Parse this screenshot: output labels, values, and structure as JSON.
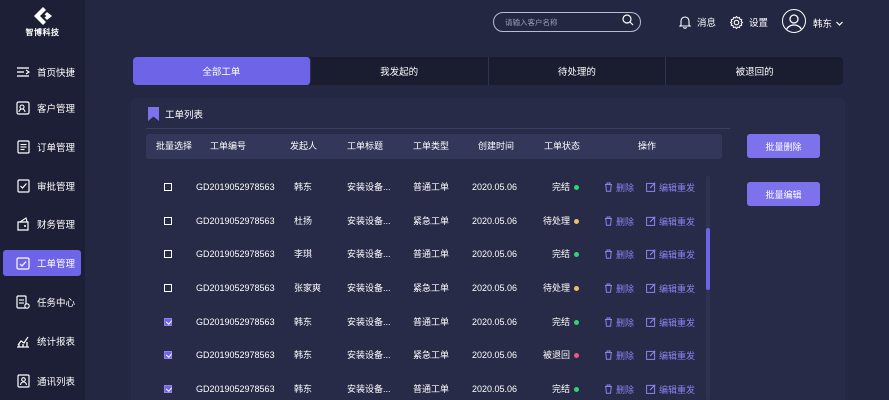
{
  "brand": {
    "name": "智博科技"
  },
  "sidebar": {
    "items": [
      {
        "label": "首页快捷",
        "icon": "quick-menu-icon",
        "active": false
      },
      {
        "label": "客户管理",
        "icon": "customer-icon",
        "active": false
      },
      {
        "label": "订单管理",
        "icon": "order-icon",
        "active": false
      },
      {
        "label": "审批管理",
        "icon": "approval-icon",
        "active": false
      },
      {
        "label": "财务管理",
        "icon": "finance-icon",
        "active": false
      },
      {
        "label": "工单管理",
        "icon": "workorder-icon",
        "active": true
      },
      {
        "label": "任务中心",
        "icon": "task-icon",
        "active": false
      },
      {
        "label": "统计报表",
        "icon": "report-icon",
        "active": false
      },
      {
        "label": "通讯列表",
        "icon": "contacts-icon",
        "active": false
      }
    ]
  },
  "header": {
    "search_placeholder": "请输入客户名称",
    "messages_label": "消息",
    "settings_label": "设置",
    "user_name": "韩东"
  },
  "tabs": [
    {
      "label": "全部工单",
      "active": true
    },
    {
      "label": "我发起的",
      "active": false
    },
    {
      "label": "待处理的",
      "active": false
    },
    {
      "label": "被退回的",
      "active": false
    }
  ],
  "panel": {
    "title": "工单列表"
  },
  "table": {
    "headers": [
      "批量选择",
      "工单编号",
      "发起人",
      "工单标题",
      "工单类型",
      "创建时间",
      "工单状态",
      "操作"
    ],
    "delete_label": "删除",
    "edit_label": "编辑重发",
    "rows": [
      {
        "checked": false,
        "id": "GD2019052978563",
        "initiator": "韩东",
        "title": "安装设备...",
        "type": "普通工单",
        "date": "2020.05.06",
        "status": "完结",
        "status_color": "#34d17a"
      },
      {
        "checked": false,
        "id": "GD2019052978563",
        "initiator": "杜扬",
        "title": "安装设备...",
        "type": "紧急工单",
        "date": "2020.05.06",
        "status": "待处理",
        "status_color": "#e8c26a"
      },
      {
        "checked": false,
        "id": "GD2019052978563",
        "initiator": "李琪",
        "title": "安装设备...",
        "type": "普通工单",
        "date": "2020.05.06",
        "status": "完结",
        "status_color": "#34d17a"
      },
      {
        "checked": false,
        "id": "GD2019052978563",
        "initiator": "张家爽",
        "title": "安装设备...",
        "type": "紧急工单",
        "date": "2020.05.06",
        "status": "待处理",
        "status_color": "#e8c26a"
      },
      {
        "checked": true,
        "id": "GD2019052978563",
        "initiator": "韩东",
        "title": "安装设备...",
        "type": "普通工单",
        "date": "2020.05.06",
        "status": "完结",
        "status_color": "#34d17a"
      },
      {
        "checked": true,
        "id": "GD2019052978563",
        "initiator": "韩东",
        "title": "安装设备...",
        "type": "紧急工单",
        "date": "2020.05.06",
        "status": "被退回",
        "status_color": "#ee5a7c"
      },
      {
        "checked": true,
        "id": "GD2019052978563",
        "initiator": "韩东",
        "title": "安装设备...",
        "type": "普通工单",
        "date": "2020.05.06",
        "status": "完结",
        "status_color": "#34d17a"
      }
    ]
  },
  "actions": {
    "batch_delete": "批量删除",
    "batch_edit": "批量编辑"
  },
  "colors": {
    "accent": "#6e64e8",
    "background": "#232742",
    "sidebar": "#1c1f35"
  }
}
